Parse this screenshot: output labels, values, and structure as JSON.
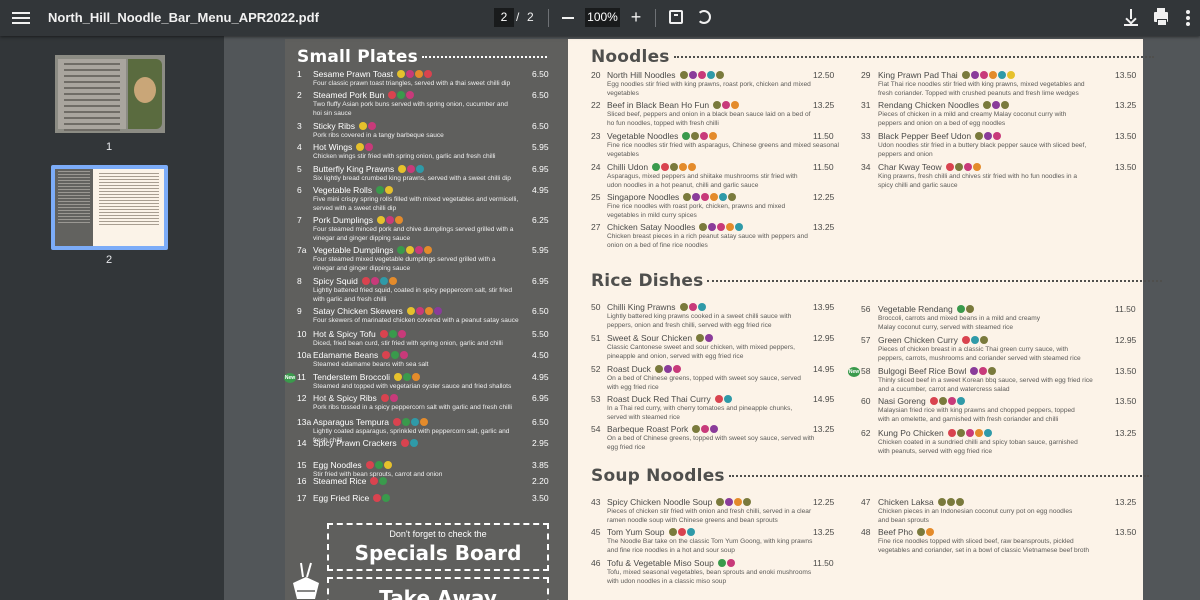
{
  "toolbar": {
    "title": "North_Hill_Noodle_Bar_Menu_APR2022.pdf",
    "current_page": "2",
    "page_sep": "/",
    "total_pages": "2",
    "zoom": "100%"
  },
  "sidebar": {
    "thumbnails": [
      {
        "label": "1"
      },
      {
        "label": "2"
      }
    ]
  },
  "colors": {
    "green": "#3a9a4c",
    "red": "#d9434f",
    "pink": "#c83a7a",
    "orange": "#e48b2b",
    "teal": "#2f9aa8",
    "yellow": "#e6c12c",
    "olive": "#7a7a3c",
    "purple": "#8a3c9a"
  },
  "small_plates": {
    "title": "Small Plates",
    "items": [
      {
        "num": "1",
        "name": "Sesame Prawn Toast",
        "price": "6.50",
        "desc": [
          "Four classic prawn toast triangles, served with a thai sweet chilli dip"
        ],
        "badges": [
          "yellow",
          "pink",
          "orange",
          "red"
        ]
      },
      {
        "num": "2",
        "name": "Steamed Pork Bun",
        "price": "6.50",
        "desc": [
          "Two fluffy Asian pork buns served with spring onion, cucumber and",
          "hoi sin sauce"
        ],
        "badges": [
          "red",
          "green",
          "pink"
        ]
      },
      {
        "num": "3",
        "name": "Sticky Ribs",
        "price": "6.50",
        "desc": [
          "Pork ribs covered in a tangy barbeque sauce"
        ],
        "badges": [
          "yellow",
          "pink"
        ]
      },
      {
        "num": "4",
        "name": "Hot Wings",
        "price": "5.95",
        "desc": [
          "Chicken wings stir fried with spring onion, garlic and fresh chilli"
        ],
        "badges": [
          "yellow",
          "pink"
        ]
      },
      {
        "num": "5",
        "name": "Butterfly King Prawns",
        "price": "6.95",
        "desc": [
          "Six lightly bread crumbed king prawns, served with a sweet chilli dip"
        ],
        "badges": [
          "yellow",
          "pink",
          "teal"
        ]
      },
      {
        "num": "6",
        "name": "Vegetable Rolls",
        "price": "4.95",
        "desc": [
          "Five mini crispy spring rolls filled with mixed vegetables and vermicelli,",
          "served with a sweet chilli dip"
        ],
        "badges": [
          "green",
          "yellow"
        ]
      },
      {
        "num": "7",
        "name": "Pork Dumplings",
        "price": "6.25",
        "desc": [
          "Four steamed minced pork and chive dumplings served grilled with a",
          "vinegar and ginger dipping sauce"
        ],
        "badges": [
          "yellow",
          "pink",
          "orange"
        ]
      },
      {
        "num": "7a",
        "name": "Vegetable Dumplings",
        "price": "5.95",
        "desc": [
          "Four steamed mixed vegetable dumplings served grilled with a",
          "vinegar and ginger dipping sauce"
        ],
        "badges": [
          "green",
          "yellow",
          "pink",
          "orange"
        ]
      },
      {
        "num": "8",
        "name": "Spicy Squid",
        "price": "6.95",
        "desc": [
          "Lightly battered fried squid, coated in spicy peppercorn salt, stir fried",
          "with garlic and fresh chilli"
        ],
        "badges": [
          "red",
          "pink",
          "teal",
          "orange"
        ]
      },
      {
        "num": "9",
        "name": "Satay Chicken Skewers",
        "price": "6.50",
        "desc": [
          "Four skewers of marinated chicken covered with a peanut satay sauce"
        ],
        "badges": [
          "yellow",
          "pink",
          "orange",
          "purple"
        ]
      },
      {
        "num": "10",
        "name": "Hot & Spicy Tofu",
        "price": "5.50",
        "desc": [
          "Diced, fried bean curd, stir fried with spring onion, garlic and chilli"
        ],
        "badges": [
          "red",
          "green",
          "pink"
        ]
      },
      {
        "num": "10a",
        "name": "Edamame Beans",
        "price": "4.50",
        "desc": [
          "Steamed edamame beans with sea salt"
        ],
        "badges": [
          "red",
          "green",
          "pink"
        ]
      },
      {
        "num": "11",
        "name": "Tenderstem Broccoli",
        "price": "4.95",
        "desc": [
          "Steamed and topped with vegetarian oyster sauce and fried shallots"
        ],
        "badges": [
          "yellow",
          "green",
          "orange"
        ],
        "new": "New"
      },
      {
        "num": "12",
        "name": "Hot & Spicy Ribs",
        "price": "6.95",
        "desc": [
          "Pork ribs tossed in a spicy peppercorn salt with garlic and fresh chilli"
        ],
        "badges": [
          "red",
          "pink"
        ]
      },
      {
        "num": "13a",
        "name": "Asparagus Tempura",
        "price": "6.50",
        "desc": [
          "Lightly coated asparagus, sprinkled with peppercorn salt, garlic and",
          "fresh chilli"
        ],
        "badges": [
          "red",
          "green",
          "teal",
          "orange"
        ]
      },
      {
        "num": "14",
        "name": "Spicy Prawn Crackers",
        "price": "2.95",
        "desc": [],
        "badges": [
          "red",
          "teal"
        ]
      },
      {
        "num": "15",
        "name": "Egg Noodles",
        "price": "3.85",
        "desc": [
          "Stir fried with bean sprouts, carrot and onion"
        ],
        "badges": [
          "red",
          "green",
          "yellow"
        ]
      },
      {
        "num": "16",
        "name": "Steamed Rice",
        "price": "2.20",
        "desc": [],
        "badges": [
          "red",
          "green"
        ]
      },
      {
        "num": "17",
        "name": "Egg Fried Rice",
        "price": "3.50",
        "desc": [],
        "badges": [
          "red",
          "green"
        ]
      }
    ]
  },
  "specials": {
    "line1": "Don't forget to check the",
    "line2": "Specials Board"
  },
  "takeaway": {
    "label": "Take Away"
  },
  "noodles": {
    "title": "Noodles",
    "left": [
      {
        "num": "20",
        "name": "North Hill Noodles",
        "price": "12.50",
        "desc": [
          "Egg noodles stir fried with king prawns, roast pork, chicken and mixed",
          "vegetables"
        ],
        "badges": [
          "olive",
          "purple",
          "pink",
          "teal",
          "olive"
        ]
      },
      {
        "num": "22",
        "name": "Beef in Black Bean Ho Fun",
        "price": "13.25",
        "desc": [
          "Sliced beef, peppers and onion in a black bean sauce laid on a bed of",
          "ho fun noodles, topped with fresh chilli"
        ],
        "badges": [
          "olive",
          "pink",
          "orange"
        ]
      },
      {
        "num": "23",
        "name": "Vegetable Noodles",
        "price": "11.50",
        "desc": [
          "Fine rice noodles stir fried with asparagus, Chinese greens and mixed seasonal",
          "vegetables"
        ],
        "badges": [
          "green",
          "olive",
          "pink",
          "orange"
        ]
      },
      {
        "num": "24",
        "name": "Chilli Udon",
        "price": "11.50",
        "desc": [
          "Asparagus, mixed peppers and shiitake mushrooms stir fried with",
          "udon noodles in a hot peanut, chilli and garlic sauce"
        ],
        "badges": [
          "green",
          "red",
          "olive",
          "orange",
          "orange"
        ]
      },
      {
        "num": "25",
        "name": "Singapore Noodles",
        "price": "12.25",
        "desc": [
          "Fine rice noodles with roast pork, chicken, prawns and mixed",
          "vegetables in mild curry spices"
        ],
        "badges": [
          "olive",
          "purple",
          "pink",
          "orange",
          "teal",
          "olive"
        ]
      },
      {
        "num": "27",
        "name": "Chicken Satay Noodles",
        "price": "13.25",
        "desc": [
          "Chicken breast pieces in a rich peanut satay sauce with peppers and",
          "onion on a bed of fine rice noodles"
        ],
        "badges": [
          "olive",
          "purple",
          "pink",
          "orange",
          "teal"
        ]
      }
    ],
    "right": [
      {
        "num": "29",
        "name": "King Prawn Pad Thai",
        "price": "13.50",
        "desc": [
          "Flat Thai rice noodles stir fried with king prawns, mixed vegetables and",
          "fresh coriander. Topped with crushed peanuts and fresh lime wedges"
        ],
        "badges": [
          "olive",
          "purple",
          "pink",
          "orange",
          "teal",
          "yellow"
        ]
      },
      {
        "num": "31",
        "name": "Rendang Chicken Noodles",
        "price": "13.25",
        "desc": [
          "Pieces of chicken in a mild and creamy Malay coconut curry with",
          "peppers and onion on a bed of egg noodles"
        ],
        "badges": [
          "olive",
          "purple",
          "olive"
        ]
      },
      {
        "num": "33",
        "name": "Black Pepper Beef Udon",
        "price": "13.50",
        "desc": [
          "Udon noodles stir fried in a buttery black pepper sauce with sliced beef,",
          "peppers and onion"
        ],
        "badges": [
          "olive",
          "purple",
          "pink"
        ]
      },
      {
        "num": "34",
        "name": "Char Kway Teow",
        "price": "13.50",
        "desc": [
          "King prawns, fresh chilli and chives stir fried with ho fun noodles in a",
          "spicy chilli and garlic sauce"
        ],
        "badges": [
          "red",
          "olive",
          "pink",
          "orange"
        ]
      }
    ]
  },
  "rice": {
    "title": "Rice Dishes",
    "left": [
      {
        "num": "50",
        "name": "Chilli King Prawns",
        "price": "13.95",
        "desc": [
          "Lightly battered king prawns cooked in a sweet chilli sauce with",
          "peppers, onion and fresh chilli, served with egg fried rice"
        ],
        "badges": [
          "olive",
          "pink",
          "teal"
        ]
      },
      {
        "num": "51",
        "name": "Sweet & Sour Chicken",
        "price": "12.95",
        "desc": [
          "Classic Cantonese sweet and sour chicken, with mixed peppers,",
          "pineapple and onion, served with egg fried rice"
        ],
        "badges": [
          "olive",
          "purple"
        ]
      },
      {
        "num": "52",
        "name": "Roast Duck",
        "price": "14.95",
        "desc": [
          "On a bed of Chinese greens, topped with sweet soy sauce, served",
          "with egg fried rice"
        ],
        "badges": [
          "olive",
          "purple",
          "pink"
        ]
      },
      {
        "num": "53",
        "name": "Roast Duck Red Thai Curry",
        "price": "14.95",
        "desc": [
          "In a Thai red curry, with cherry tomatoes and pineapple chunks,",
          "served with steamed rice"
        ],
        "badges": [
          "red",
          "teal"
        ]
      },
      {
        "num": "54",
        "name": "Barbeque Roast Pork",
        "price": "13.25",
        "desc": [
          "On a bed of Chinese greens, topped with sweet soy sauce, served with",
          "egg fried rice"
        ],
        "badges": [
          "olive",
          "pink",
          "purple"
        ]
      }
    ],
    "right": [
      {
        "num": "56",
        "name": "Vegetable Rendang",
        "price": "11.50",
        "desc": [
          "Broccoli, carrots and mixed beans in a mild and creamy",
          "Malay coconut curry, served with steamed rice"
        ],
        "badges": [
          "green",
          "olive"
        ]
      },
      {
        "num": "57",
        "name": "Green Chicken Curry",
        "price": "12.95",
        "desc": [
          "Pieces of chicken breast in a classic Thai green curry sauce, with",
          "peppers, carrots, mushrooms and coriander served with steamed rice"
        ],
        "badges": [
          "red",
          "teal",
          "olive"
        ]
      },
      {
        "num": "58",
        "name": "Bulgogi Beef Rice Bowl",
        "price": "13.50",
        "desc": [
          "Thinly sliced beef in a sweet Korean bbq sauce, served with egg fried rice",
          "and a cucumber, carrot and watercress salad"
        ],
        "badges": [
          "purple",
          "pink",
          "olive"
        ],
        "new": "New"
      },
      {
        "num": "60",
        "name": "Nasi Goreng",
        "price": "13.50",
        "desc": [
          "Malaysian fried rice with king prawns and chopped peppers, topped",
          "with an omelette, and garnished with fresh coriander and chilli"
        ],
        "badges": [
          "red",
          "olive",
          "pink",
          "teal"
        ]
      },
      {
        "num": "62",
        "name": "Kung Po Chicken",
        "price": "13.25",
        "desc": [
          "Chicken coated in a sundried chilli and spicy toban sauce, garnished",
          "with peanuts, served with egg fried rice"
        ],
        "badges": [
          "red",
          "olive",
          "pink",
          "orange",
          "teal"
        ]
      }
    ]
  },
  "soup": {
    "title": "Soup Noodles",
    "left": [
      {
        "num": "43",
        "name": "Spicy Chicken Noodle Soup",
        "price": "12.25",
        "desc": [
          "Pieces of chicken stir fried with onion and fresh chilli, served in a clear",
          "ramen noodle soup with Chinese greens and bean sprouts"
        ],
        "badges": [
          "olive",
          "purple",
          "orange",
          "olive"
        ]
      },
      {
        "num": "45",
        "name": "Tom Yum Soup",
        "price": "13.25",
        "desc": [
          "The Noodle Bar take on the classic Tom Yum Goong, with king prawns",
          "and fine rice noodles in a hot and sour soup"
        ],
        "badges": [
          "olive",
          "red",
          "teal"
        ]
      },
      {
        "num": "46",
        "name": "Tofu & Vegetable Miso Soup",
        "price": "11.50",
        "desc": [
          "Tofu, mixed seasonal vegetables, bean sprouts and enoki mushrooms",
          "with udon noodles in a classic miso soup"
        ],
        "badges": [
          "green",
          "pink"
        ]
      }
    ],
    "right": [
      {
        "num": "47",
        "name": "Chicken Laksa",
        "price": "13.25",
        "desc": [
          "Chicken pieces in an Indonesian coconut curry pot on egg noodles",
          "and bean sprouts"
        ],
        "badges": [
          "olive",
          "olive",
          "olive"
        ]
      },
      {
        "num": "48",
        "name": "Beef Pho",
        "price": "13.50",
        "desc": [
          "Fine rice noodles topped with sliced beef, raw beansprouts, pickled",
          "vegetables and coriander, set in a bowl of classic Vietnamese beef broth"
        ],
        "badges": [
          "olive",
          "orange"
        ]
      }
    ]
  }
}
